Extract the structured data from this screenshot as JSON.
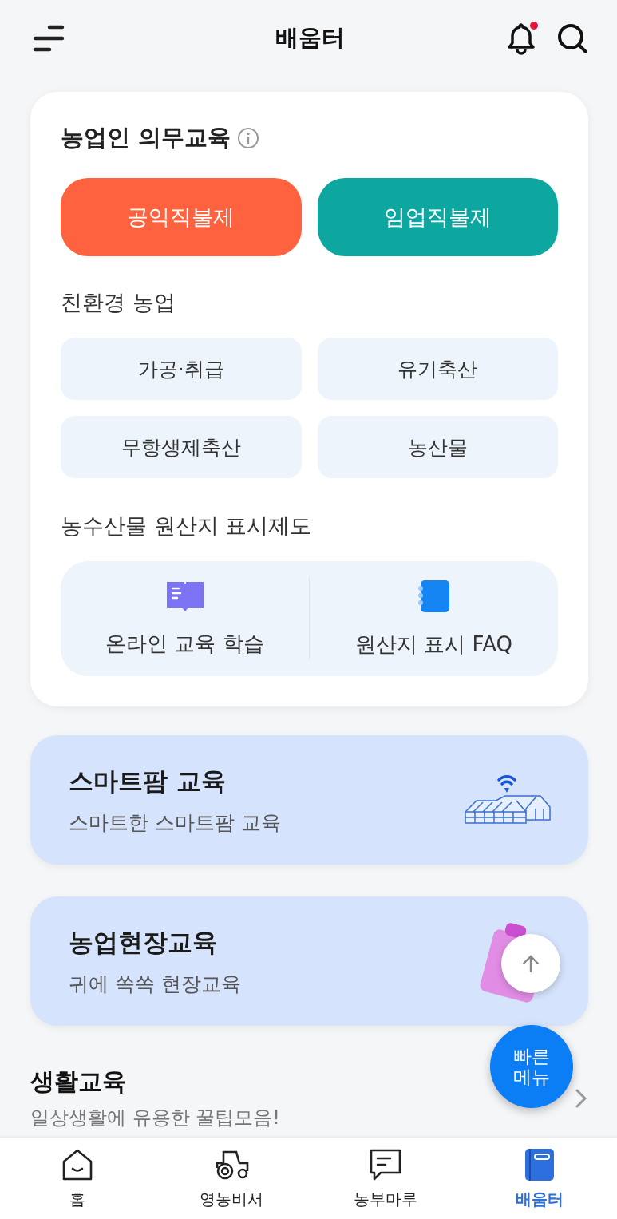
{
  "header": {
    "title": "배움터",
    "notification_unread": true
  },
  "mandatory": {
    "title": "농업인 의무교육",
    "buttons": [
      {
        "label": "공익직불제",
        "color": "#ff623f"
      },
      {
        "label": "임업직불제",
        "color": "#0ea79f"
      }
    ]
  },
  "eco": {
    "title": "친환경 농업",
    "items": [
      "가공·취급",
      "유기축산",
      "무항생제축산",
      "농산물"
    ]
  },
  "origin": {
    "title": "농수산물 원산지 표시제도",
    "items": [
      {
        "label": "온라인 교육 학습",
        "kind": "book"
      },
      {
        "label": "원산지 표시 FAQ",
        "kind": "notebook"
      }
    ]
  },
  "banners": [
    {
      "title": "스마트팜 교육",
      "subtitle": "스마트한 스마트팜 교육",
      "kind": "greenhouse"
    },
    {
      "title": "농업현장교육",
      "subtitle": "귀에 쏙쏙 현장교육",
      "kind": "clipboard"
    }
  ],
  "life": {
    "title": "생활교육",
    "subtitle": "일상생활에 유용한 꿀팁모음!"
  },
  "quick_menu": {
    "label": "빠른\n메뉴"
  },
  "bottom_nav": [
    {
      "label": "홈",
      "kind": "home",
      "selected": false
    },
    {
      "label": "영농비서",
      "kind": "tractor",
      "selected": false
    },
    {
      "label": "농부마루",
      "kind": "chat",
      "selected": false
    },
    {
      "label": "배움터",
      "kind": "book",
      "selected": true
    }
  ]
}
